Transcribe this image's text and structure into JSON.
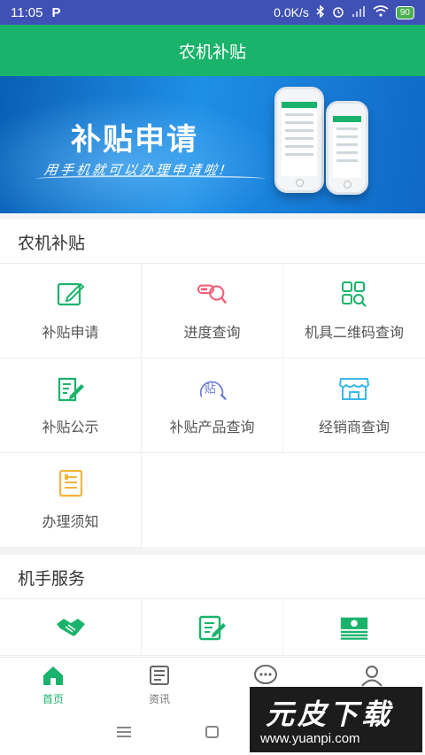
{
  "status_bar": {
    "time": "11:05",
    "app_glyph": "P",
    "net_speed": "0.0K/s",
    "battery": "90"
  },
  "header": {
    "title": "农机补贴"
  },
  "banner": {
    "headline": "补贴申请",
    "slogan": "用手机就可以办理申请啦!"
  },
  "sections": [
    {
      "title": "农机补贴",
      "items": [
        {
          "label": "补贴申请",
          "icon": "edit-box-icon",
          "color": "#1ab36b"
        },
        {
          "label": "进度查询",
          "icon": "progress-search-icon",
          "color": "#f0607a"
        },
        {
          "label": "机具二维码查询",
          "icon": "qr-code-search-icon",
          "color": "#1ab36b"
        },
        {
          "label": "补贴公示",
          "icon": "notice-edit-icon",
          "color": "#1ab36b"
        },
        {
          "label": "补贴产品查询",
          "icon": "subsidy-product-search-icon",
          "color": "#6e7bd6"
        },
        {
          "label": "经销商查询",
          "icon": "store-icon",
          "color": "#3bb8e8"
        },
        {
          "label": "办理须知",
          "icon": "guide-doc-icon",
          "color": "#f2b43a"
        }
      ]
    },
    {
      "title": "机手服务",
      "items": [
        {
          "label": "",
          "icon": "handshake-icon",
          "color": "#1ab36b"
        },
        {
          "label": "",
          "icon": "form-edit-icon",
          "color": "#1ab36b"
        },
        {
          "label": "",
          "icon": "money-icon",
          "color": "#1ab36b"
        }
      ]
    }
  ],
  "tabbar": {
    "tabs": [
      {
        "label": "首页",
        "icon": "home-icon",
        "active": true
      },
      {
        "label": "资讯",
        "icon": "news-icon",
        "active": false
      },
      {
        "label": "",
        "icon": "chat-icon",
        "active": false
      },
      {
        "label": "",
        "icon": "user-icon",
        "active": false
      }
    ]
  },
  "watermark": {
    "brand": "元皮下载",
    "url": "www.yuanpi.com"
  },
  "colors": {
    "primary": "#1ab36b",
    "status_bar": "#3f51b5"
  }
}
